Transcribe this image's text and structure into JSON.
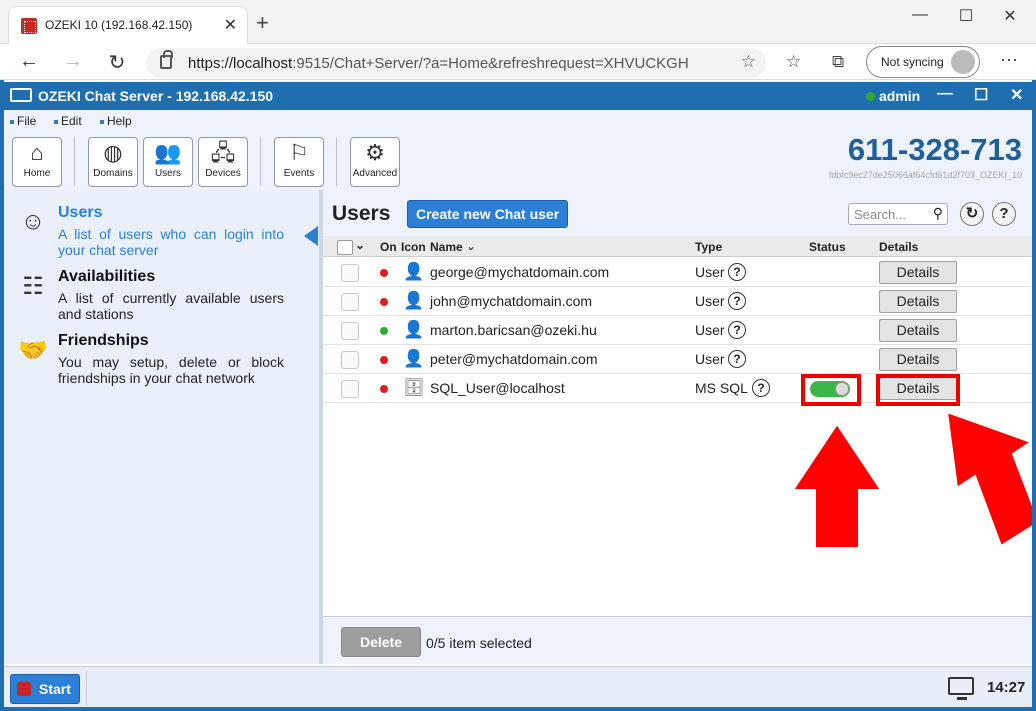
{
  "browser": {
    "tab_title": "OZEKI 10 (192.168.42.150)",
    "tab_close": "✕",
    "new_tab": "+",
    "url_host": "https://localhost",
    "url_rest": ":9515/Chat+Server/?a=Home&refreshrequest=XHVUCKGH",
    "sync_label": "Not syncing",
    "win_min": "—",
    "win_max": "☐",
    "win_close": "✕"
  },
  "app": {
    "title": "OZEKI Chat Server - 192.168.42.150",
    "user": "admin",
    "ctl_min": "—",
    "ctl_max": "☐",
    "ctl_close": "✕"
  },
  "menu": [
    "File",
    "Edit",
    "Help"
  ],
  "toolbar": {
    "buttons": [
      "Home",
      "Domains",
      "Users",
      "Devices",
      "Events",
      "Advanced"
    ],
    "phone": "611-328-713",
    "hash": "fdbfc9ec27de25066af64cfd61d2f703_OZEKI_10"
  },
  "sidebar": {
    "items": [
      {
        "title": "Users",
        "desc": "A list of users who can login into your chat server"
      },
      {
        "title": "Availabilities",
        "desc": "A list of currently available users and stations"
      },
      {
        "title": "Friendships",
        "desc": "You may setup, delete or block friendships in your chat network"
      }
    ]
  },
  "main": {
    "title": "Users",
    "create_button": "Create new Chat user",
    "search_placeholder": "Search...",
    "columns": {
      "on": "On",
      "icon": "Icon",
      "name": "Name",
      "type": "Type",
      "status": "Status",
      "details": "Details"
    },
    "rows": [
      {
        "name": "george@mychatdomain.com",
        "type": "User",
        "online": false,
        "details": "Details"
      },
      {
        "name": "john@mychatdomain.com",
        "type": "User",
        "online": false,
        "details": "Details"
      },
      {
        "name": "marton.baricsan@ozeki.hu",
        "type": "User",
        "online": true,
        "details": "Details"
      },
      {
        "name": "peter@mychatdomain.com",
        "type": "User",
        "online": false,
        "details": "Details"
      },
      {
        "name": "SQL_User@localhost",
        "type": "MS SQL",
        "online": false,
        "details": "Details",
        "status_enabled": true
      }
    ],
    "delete_button": "Delete",
    "selection_info": "0/5 item selected"
  },
  "taskbar": {
    "start": "Start",
    "time": "14:27"
  },
  "colors": {
    "accent": "#2b7fd6",
    "header": "#1f6fb0",
    "online": "#2eaa2e",
    "offline": "#e01b1b",
    "highlight": "#e00000"
  }
}
